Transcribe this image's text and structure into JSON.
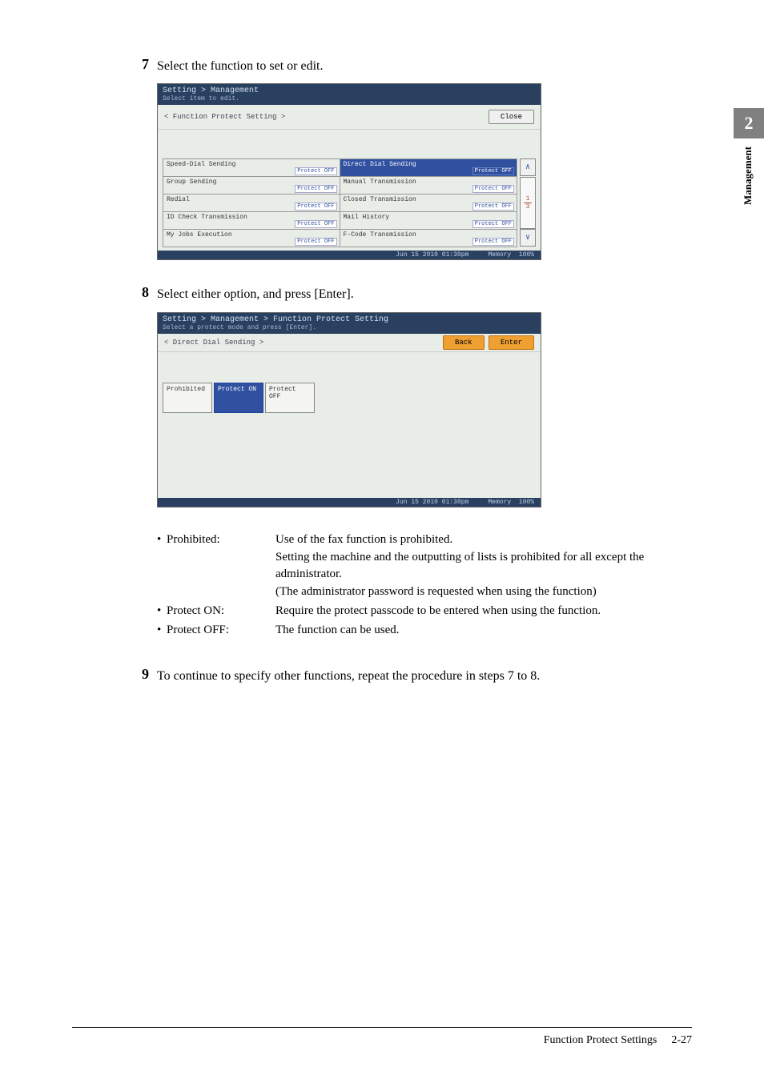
{
  "sidebar": {
    "chapter_num": "2",
    "chapter_label": "Management"
  },
  "step7": {
    "num": "7",
    "text": "Select the function to set or edit."
  },
  "screen1": {
    "breadcrumb": "Setting > Management",
    "subtitle": "Select item to edit.",
    "section_label": "< Function Protect Setting >",
    "close_btn": "Close",
    "items": [
      {
        "name": "Speed-Dial Sending",
        "status": "Protect OFF"
      },
      {
        "name": "Direct Dial Sending",
        "status": "Protect OFF",
        "highlight": true
      },
      {
        "name": "Group Sending",
        "status": "Protect OFF"
      },
      {
        "name": "Manual Transmission",
        "status": "Protect OFF"
      },
      {
        "name": "Redial",
        "status": "Protect OFF"
      },
      {
        "name": "Closed Transmission",
        "status": "Protect OFF"
      },
      {
        "name": "ID Check Transmission",
        "status": "Protect OFF"
      },
      {
        "name": "Mail History",
        "status": "Protect OFF"
      },
      {
        "name": "My Jobs Execution",
        "status": "Protect OFF"
      },
      {
        "name": "F-Code Transmission",
        "status": "Protect OFF"
      }
    ],
    "scroll_up": "∧",
    "scroll_down": "∨",
    "page_cur": "1",
    "page_total": "3",
    "footer_date": "Jun 15 2010 01:30pm",
    "footer_mem": "Memory",
    "footer_pct": "100%"
  },
  "step8": {
    "num": "8",
    "text": "Select either option, and press [Enter]."
  },
  "screen2": {
    "breadcrumb": "Setting > Management > Function Protect Setting",
    "subtitle": "Select a protect mode and press [Enter].",
    "section_label": "< Direct Dial Sending >",
    "back_btn": "Back",
    "enter_btn": "Enter",
    "opt1": "Prohibited",
    "opt2": "Protect ON",
    "opt3": "Protect OFF",
    "footer_date": "Jun 15 2010 01:30pm",
    "footer_mem": "Memory",
    "footer_pct": "100%"
  },
  "definitions": {
    "prohibited": {
      "term": "Prohibited:",
      "line1": "Use of the fax function is prohibited.",
      "line2": "Setting the machine and the outputting of lists is prohibited for all except the administrator.",
      "line3": "(The administrator password is requested when using the function)"
    },
    "protect_on": {
      "term": "Protect ON:",
      "desc": "Require the protect passcode to be entered when using the function."
    },
    "protect_off": {
      "term": "Protect OFF:",
      "desc": "The function can be used."
    }
  },
  "step9": {
    "num": "9",
    "text": "To continue to specify other functions, repeat the procedure in steps 7 to 8."
  },
  "footer": {
    "title": "Function Protect Settings",
    "page": "2-27"
  }
}
